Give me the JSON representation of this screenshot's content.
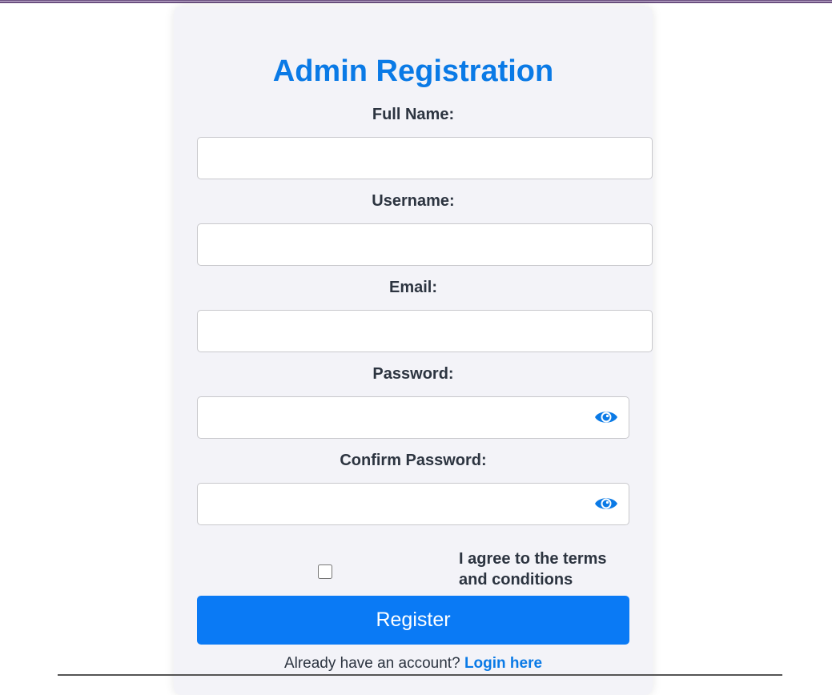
{
  "form": {
    "title": "Admin Registration",
    "fields": {
      "full_name": {
        "label": "Full Name:",
        "value": "",
        "placeholder": ""
      },
      "username": {
        "label": "Username:",
        "value": "",
        "placeholder": ""
      },
      "email": {
        "label": "Email:",
        "value": "",
        "placeholder": ""
      },
      "password": {
        "label": "Password:",
        "value": "",
        "placeholder": ""
      },
      "confirm_password": {
        "label": "Confirm Password:",
        "value": "",
        "placeholder": ""
      }
    },
    "terms_label": "I agree to the terms and conditions",
    "terms_checked": false,
    "register_label": "Register",
    "login_prompt": "Already have an account?",
    "login_link": "Login here"
  },
  "icons": {
    "password_toggle": "eye-icon",
    "confirm_password_toggle": "eye-icon"
  },
  "colors": {
    "accent": "#0a7af5",
    "title": "#0a7ae6",
    "card_background": "#f3f3f8",
    "label_text": "#2c3440"
  }
}
